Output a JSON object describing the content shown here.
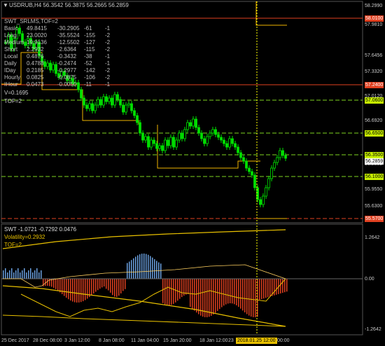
{
  "chart": {
    "symbol_header": "USDRUB,H4  56.3542 56.3875 56.2665 56.2859",
    "swt_header": "SWT_SRLMS,TOF=2",
    "vol_line": "V=0.1695",
    "tof_line": "TOF=2",
    "header_arrow": "▼",
    "table": [
      {
        "name": "Basic",
        "v1": "49.8415",
        "v2": "-30.2905",
        "v3": "-61",
        "v4": "-1"
      },
      {
        "name": "Long",
        "v1": "23.0020",
        "v2": "-35.5524",
        "v3": "-155",
        "v4": "-2"
      },
      {
        "name": "Medium",
        "v1": "19.9136",
        "v2": "-12.5502",
        "v3": "-127",
        "v4": "-2"
      },
      {
        "name": "Short",
        "v1": "2.2932",
        "v2": "-2.6364",
        "v3": "-115",
        "v4": "-2"
      },
      {
        "name": "Local",
        "v1": "0.4876",
        "v2": "-0.3432",
        "v3": "-38",
        "v4": "-1"
      },
      {
        "name": "Daily",
        "v1": "0.4788",
        "v2": "-0.2474",
        "v3": "-52",
        "v4": "-1"
      },
      {
        "name": "IDay",
        "v1": "0.2185",
        "v2": "-0.2977",
        "v3": "-142",
        "v4": "-2"
      },
      {
        "name": "Hourly",
        "v1": "0.0825",
        "v2": "-0.0875",
        "v3": "-106",
        "v4": "-2"
      },
      {
        "name": "IHour",
        "v1": "0.0473",
        "v2": "-0.0050",
        "v3": "-11",
        "v4": "-1"
      }
    ],
    "price_axis": [
      "58.2990",
      "57.9810",
      "57.6456",
      "57.3320",
      "57.0120",
      "56.6920",
      "56.2859",
      "55.9550",
      "55.6300"
    ],
    "price_labels": [
      {
        "text": "58.0100",
        "color": "#e04020",
        "bg": "#e04020",
        "fg": "#ffffff"
      },
      {
        "text": "57.2400",
        "color": "#e04020",
        "bg": "#e04020",
        "fg": "#ffffff"
      },
      {
        "text": "57.0600",
        "color": "#7ed321",
        "bg": "#c8f000",
        "fg": "#000000"
      },
      {
        "text": "56.6500",
        "color": "#7ed321",
        "bg": "#c8f000",
        "fg": "#000000"
      },
      {
        "text": "56.3500",
        "color": "#7ed321",
        "bg": "#c8f000",
        "fg": "#000000"
      },
      {
        "text": "56.2859",
        "color": "#ffffff",
        "bg": "#ffffff",
        "fg": "#000000"
      },
      {
        "text": "56.1000",
        "color": "#7ed321",
        "bg": "#c8f000",
        "fg": "#000000"
      },
      {
        "text": "55.5700",
        "color": "#e04020",
        "bg": "#e04020",
        "fg": "#ffffff"
      }
    ],
    "swt_panel": {
      "header": "SWT -1.0721 -0.7292 0.0476",
      "volatility": "Volatility=0.2932",
      "tof": "TOF=2",
      "axis": [
        "1.2642",
        "0.00",
        "-1.2642"
      ]
    },
    "time_axis": [
      "25 Dec 2017",
      "28 Dec 08:00",
      "3 Jan 12:00",
      "8 Jan 08:00",
      "11 Jan 04:00",
      "15 Jan 20:00",
      "18 Jan 12:00",
      "23",
      "2018.01.25 12:00",
      "00:00"
    ],
    "colors": {
      "background": "#000000",
      "candle": "#00e000",
      "resistance": "#e04020",
      "support": "#7ed321",
      "highlight": "#ffff00",
      "histogram_up": "#6aa0e0",
      "histogram_down": "#e04020"
    }
  }
}
